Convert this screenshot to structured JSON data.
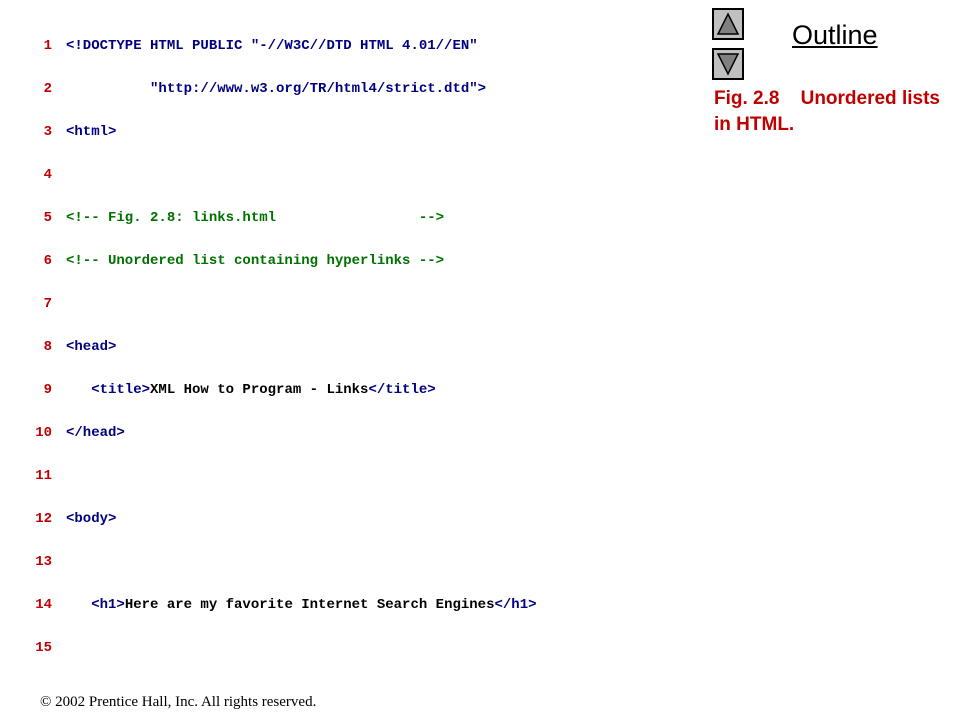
{
  "nav": {
    "up_icon": "triangle-up-icon",
    "down_icon": "triangle-down-icon"
  },
  "outline_label": "Outline",
  "caption": {
    "fig": "Fig. 2.8",
    "text": "Unordered lists in HTML."
  },
  "code": {
    "lines": [
      {
        "n": "1",
        "text": "<!DOCTYPE HTML PUBLIC \"-//W3C//DTD HTML 4.01//EN\""
      },
      {
        "n": "2",
        "text": "          \"http://www.w3.org/TR/html4/strict.dtd\">"
      },
      {
        "n": "3",
        "text": "<html>"
      },
      {
        "n": "4",
        "text": ""
      },
      {
        "n": "5",
        "text": "<!-- Fig. 2.8: links.html                 -->"
      },
      {
        "n": "6",
        "text": "<!-- Unordered list containing hyperlinks -->"
      },
      {
        "n": "7",
        "text": ""
      },
      {
        "n": "8",
        "text": "<head>"
      },
      {
        "n": "9",
        "text": "   <title>XML How to Program - Links</title>"
      },
      {
        "n": "10",
        "text": "</head>"
      },
      {
        "n": "11",
        "text": ""
      },
      {
        "n": "12",
        "text": "<body>"
      },
      {
        "n": "13",
        "text": ""
      },
      {
        "n": "14",
        "text": "   <h1>Here are my favorite Internet Search Engines</h1>"
      },
      {
        "n": "15",
        "text": ""
      }
    ]
  },
  "footer": "© 2002 Prentice Hall, Inc.  All rights reserved."
}
